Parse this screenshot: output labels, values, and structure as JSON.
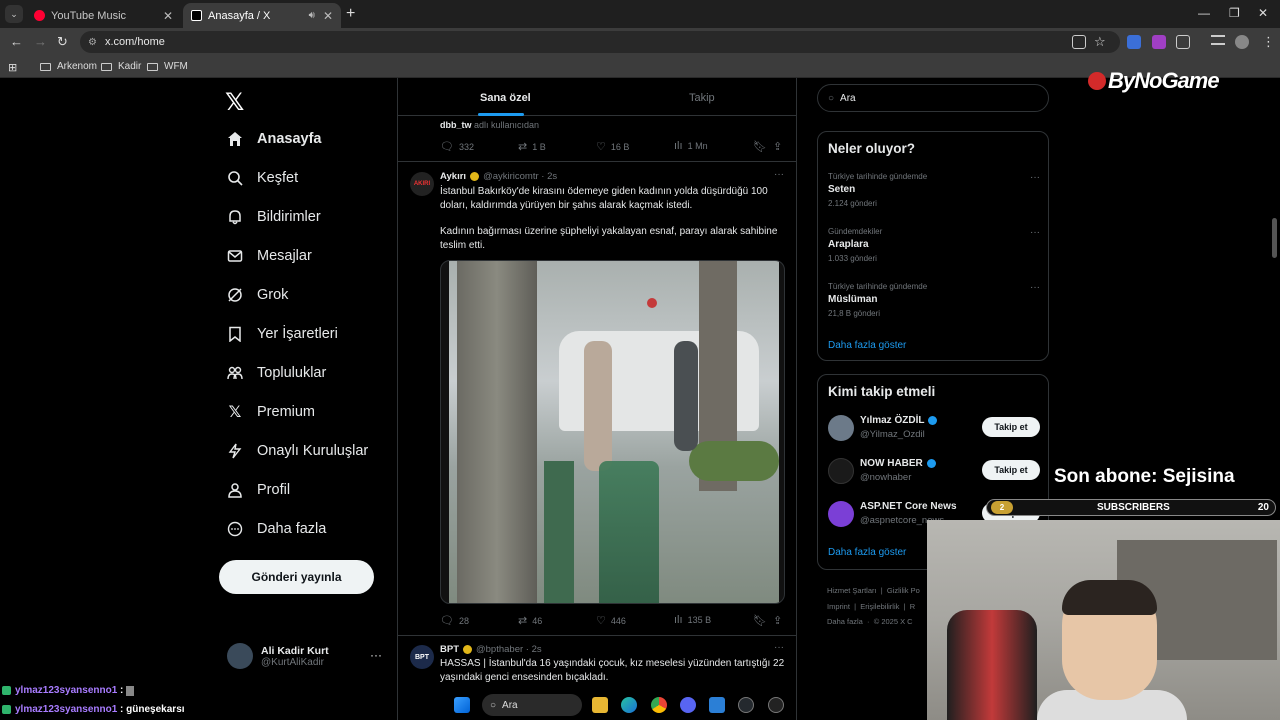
{
  "browser": {
    "tabs": [
      {
        "title": "YouTube Music",
        "color": "#ff0033"
      },
      {
        "title": "Anasayfa / X",
        "color": "#ffffff"
      }
    ],
    "url": "x.com/home",
    "bookmarks": [
      "Arkenom",
      "Kadir",
      "WFM"
    ]
  },
  "sidebar": {
    "items": [
      {
        "label": "Anasayfa",
        "icon": "home-icon"
      },
      {
        "label": "Keşfet",
        "icon": "search-icon"
      },
      {
        "label": "Bildirimler",
        "icon": "bell-icon"
      },
      {
        "label": "Mesajlar",
        "icon": "mail-icon"
      },
      {
        "label": "Grok",
        "icon": "grok-icon"
      },
      {
        "label": "Yer İşaretleri",
        "icon": "bookmark-icon"
      },
      {
        "label": "Topluluklar",
        "icon": "people-icon"
      },
      {
        "label": "Premium",
        "icon": "x-icon"
      },
      {
        "label": "Onaylı Kuruluşlar",
        "icon": "lightning-icon"
      },
      {
        "label": "Profil",
        "icon": "person-icon"
      },
      {
        "label": "Daha fazla",
        "icon": "more-circle-icon"
      }
    ],
    "post_button": "Gönderi yayınla",
    "account": {
      "name": "Ali Kadir Kurt",
      "handle": "@KurtAliKadir"
    }
  },
  "feed": {
    "tabs": [
      "Sana özel",
      "Takip"
    ],
    "prev": {
      "user": "dbb_tw",
      "note": "adlı kullanıcıdan",
      "replies": "332",
      "reposts": "1 B",
      "likes": "16 B",
      "views": "1 Mn"
    },
    "tweet1": {
      "name": "Aykırı",
      "handle": "@aykiricomtr · 2s",
      "avatar_label": "AKIRI",
      "text1": "İstanbul Bakırköy'de kirasını ödemeye giden kadının yolda düşürdüğü 100 doları, kaldırımda yürüyen bir şahıs alarak kaçmak istedi.",
      "text2": "Kadının bağırması üzerine şüpheliyi yakalayan esnaf, parayı alarak sahibine teslim etti.",
      "replies": "28",
      "reposts": "46",
      "likes": "446",
      "views": "135 B"
    },
    "tweet2": {
      "name": "BPT",
      "handle": "@bpthaber · 2s",
      "avatar_label": "BPT",
      "text": "HASSAS | İstanbul'da 16 yaşındaki çocuk, kız meselesi yüzünden tartıştığı 22 yaşındaki genci ensesinden bıçakladı."
    }
  },
  "right": {
    "search_placeholder": "Ara",
    "trends_title": "Neler oluyor?",
    "trends": [
      {
        "context": "Türkiye tarihinde gündemde",
        "title": "Seten",
        "posts": "2.124 gönderi"
      },
      {
        "context": "Gündemdekiler",
        "title": "Araplara",
        "posts": "1.033 gönderi"
      },
      {
        "context": "Türkiye tarihinde gündemde",
        "title": "Müslüman",
        "posts": "21,8 B gönderi"
      }
    ],
    "show_more": "Daha fazla göster",
    "who_title": "Kimi takip etmeli",
    "who": [
      {
        "name": "Yılmaz ÖZDİL",
        "handle": "@Yilmaz_Ozdil",
        "color": "#6c7a89"
      },
      {
        "name": "NOW HABER",
        "handle": "@nowhaber",
        "color": "#1a1a1a"
      },
      {
        "name": "ASP.NET Core News",
        "handle": "@aspnetcore_news",
        "color": "#7b3fd6"
      }
    ],
    "follow_label": "Takip et",
    "footer": [
      "Hizmet Şartları",
      "Gizlilik Po",
      "Imprint",
      "Erişilebilirlik",
      "R",
      "Daha fazla",
      "© 2025 X C"
    ]
  },
  "overlay": {
    "brand": "ByNoGame",
    "last_sub": "Son abone: Sejisina",
    "subs_label": "SUBSCRIBERS",
    "subs_count": "20",
    "subs_badge": "2",
    "chat": [
      {
        "user": "ylmaz123syansenno1",
        "msg": ""
      },
      {
        "user": "ylmaz123syansenno1",
        "msg": "güneşekarsı"
      }
    ]
  },
  "taskbar": {
    "search": "Ara"
  }
}
